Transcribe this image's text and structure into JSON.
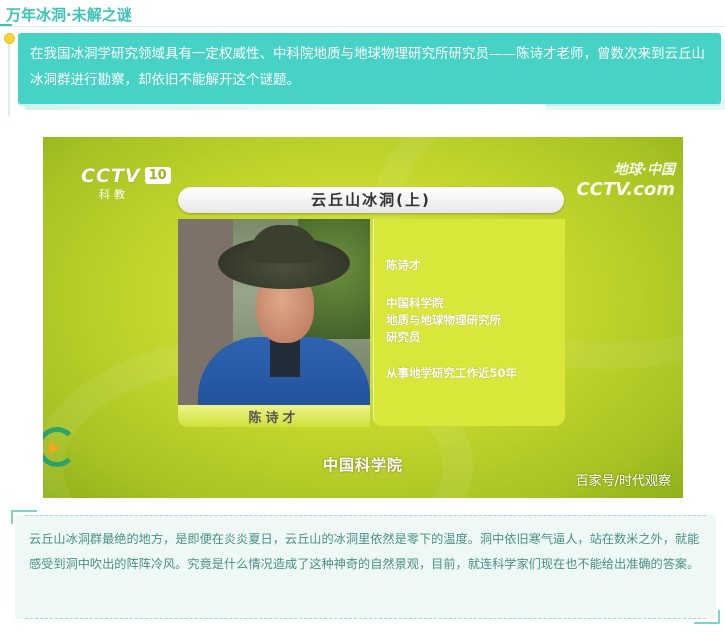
{
  "header": {
    "section_title": "万年冰洞·未解之谜",
    "intro_text": "在我国冰洞学研究领域具有一定权威性、中科院地质与地球物理研究所研究员——陈诗才老师，曾数次来到云丘山冰洞群进行勘察，却依旧不能解开这个谜题。"
  },
  "video_frame": {
    "channel_logo": "CCTV",
    "channel_number": "10",
    "channel_subtitle": "科教",
    "corner_logo_cn": "地球·中国",
    "corner_logo_en": "CCTV.com",
    "program_title": "云丘山冰洞(上)",
    "interviewee_name": "陈诗才",
    "info_name": "陈诗才",
    "info_org_1": "中国科学院",
    "info_org_2": "地质与地球物理研究所",
    "info_role": "研究员",
    "info_note": "从事地学研究工作近50年",
    "caption": "中国科学院",
    "watermark": "百家号/时代观察"
  },
  "footer": {
    "body_text": "云丘山冰洞群最绝的地方，是即便在炎炎夏日，云丘山的冰洞里依然是零下的温度。洞中依旧寒气逼人，站在数米之外，就能感受到洞中吹出的阵阵冷风。究竟是什么情况造成了这种神奇的自然景观，目前，就连科学家们现在也不能给出准确的答案。"
  },
  "colors": {
    "accent": "#46d3c5",
    "title": "#3cc3b4",
    "dot": "#f7d43b",
    "tv_green": "#c5d72e",
    "footer_text": "#4b8f86"
  }
}
